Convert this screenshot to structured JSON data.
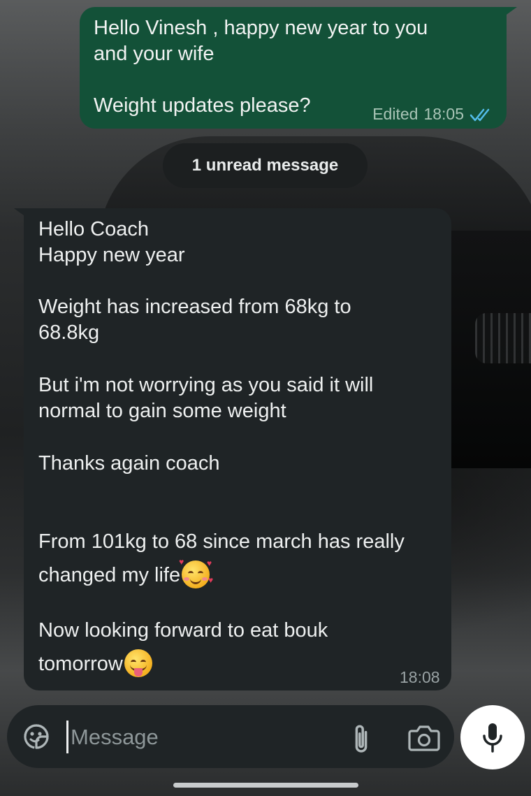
{
  "chat": {
    "outgoing": {
      "text": "Hello Vinesh , happy new year to you\nand your wife\n\nWeight updates please?",
      "edited_label": "Edited",
      "time": "18:05",
      "status_icon": "double-check-icon"
    },
    "unread_banner": "1 unread message",
    "incoming": {
      "lines": [
        "Hello Coach",
        "Happy new year",
        "Weight has increased from 68kg to",
        "68.8kg",
        "But i'm not worrying as you said it will",
        "normal to gain some weight",
        "Thanks again coach",
        "From 101kg to 68 since march has really",
        "changed my life",
        "Now looking forward to eat bouk",
        "tomorrow"
      ],
      "emojis": [
        "smiling-face-with-hearts",
        "face-with-tongue"
      ],
      "time": "18:08"
    }
  },
  "composer": {
    "placeholder": "Message",
    "icons": [
      "sticker-icon",
      "attach-icon",
      "camera-icon",
      "mic-icon"
    ]
  },
  "colors": {
    "outgoing_bubble": "#135138",
    "incoming_bubble": "#1f2426",
    "read_ticks": "#53bdeb"
  }
}
